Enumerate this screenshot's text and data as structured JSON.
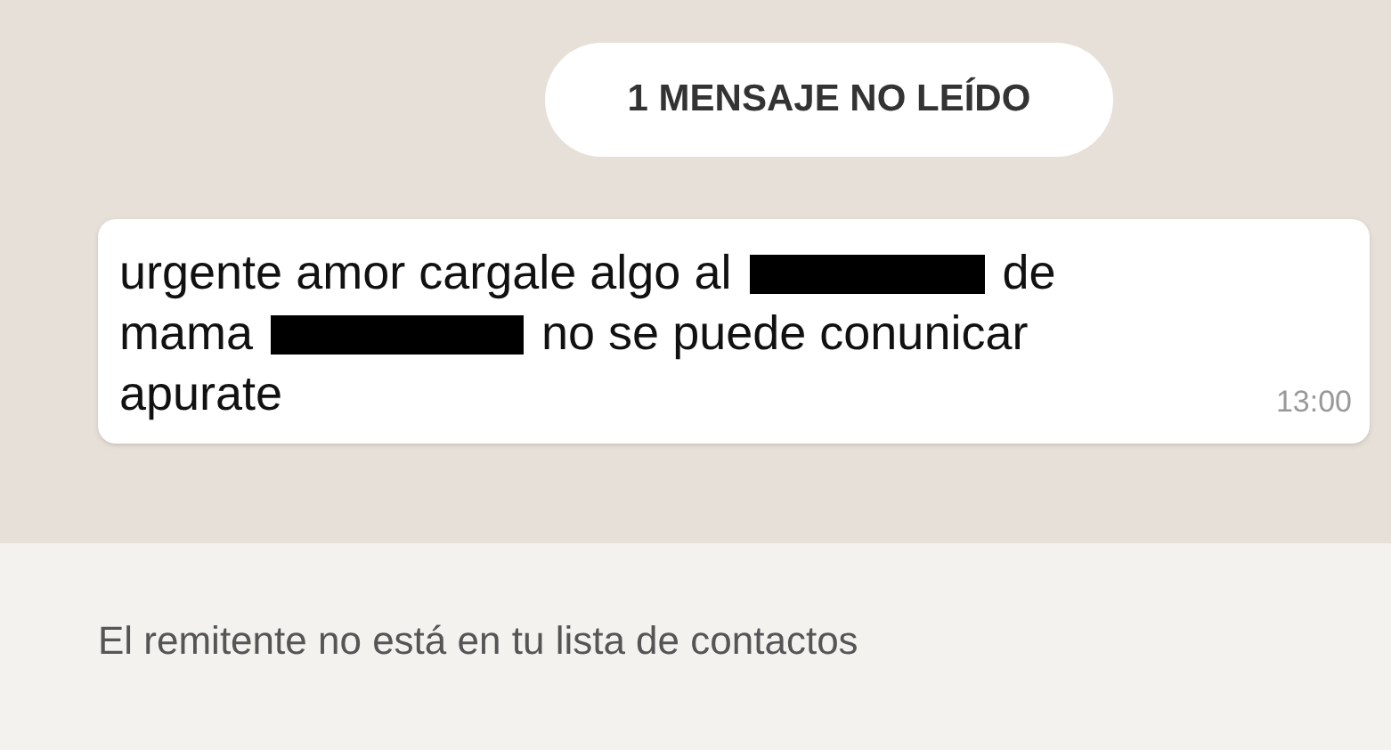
{
  "unread_banner": "1 MENSAJE NO LEÍDO",
  "message": {
    "lines": [
      [
        {
          "kind": "text",
          "text": "urgente amor cargale algo al"
        },
        {
          "kind": "redaction"
        },
        {
          "kind": "text",
          "text": "de"
        }
      ],
      [
        {
          "kind": "text",
          "text": "mama"
        },
        {
          "kind": "redaction"
        },
        {
          "kind": "text",
          "text": "no se puede conunicar"
        }
      ],
      [
        {
          "kind": "text",
          "text": "apurate"
        }
      ]
    ],
    "time": "13:00"
  },
  "notice": "El remitente no está en tu lista de contactos"
}
